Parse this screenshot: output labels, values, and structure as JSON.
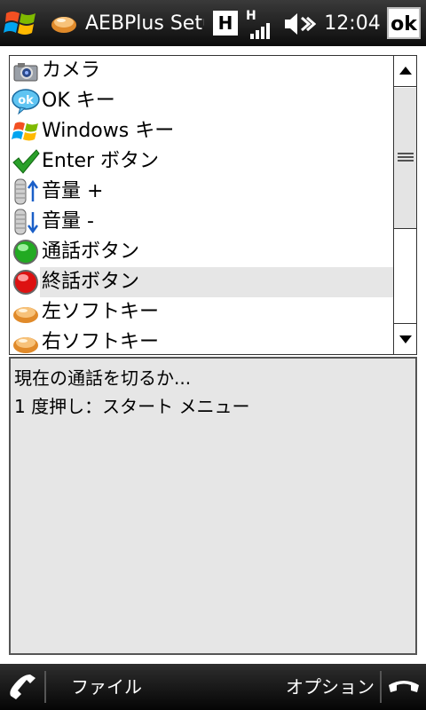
{
  "titlebar": {
    "app_title": "AEBPlus Setu",
    "network_type": "H",
    "signal_type": "H",
    "time": "12:04",
    "ok_label": "ok",
    "icons": [
      "windows-start-icon",
      "app-icon",
      "signal-strength-icon",
      "speaker-muted-icon"
    ]
  },
  "list": {
    "items": [
      {
        "label": "カメラ",
        "icon": "camera-icon"
      },
      {
        "label": "OK キー",
        "icon": "ok-key-icon"
      },
      {
        "label": "Windows キー",
        "icon": "windows-key-icon"
      },
      {
        "label": "Enter ボタン",
        "icon": "checkmark-icon"
      },
      {
        "label": "音量 +",
        "icon": "volume-up-icon"
      },
      {
        "label": "音量 -",
        "icon": "volume-down-icon"
      },
      {
        "label": "通話ボタン",
        "icon": "green-call-icon"
      },
      {
        "label": "終話ボタン",
        "icon": "red-end-call-icon"
      },
      {
        "label": "左ソフトキー",
        "icon": "left-softkey-icon"
      },
      {
        "label": "右ソフトキー",
        "icon": "right-softkey-icon"
      }
    ],
    "selected_index": 7
  },
  "description": {
    "line1": "現在の通話を切るか...",
    "line2": "1 度押し：スタート メニュー"
  },
  "bottombar": {
    "left_softkey": "ファイル",
    "right_softkey": "オプション"
  },
  "colors": {
    "titlebar_bg": "#1a1a1a",
    "selected_bg": "#e6e6e6",
    "description_bg": "#e6e6e6",
    "check_green": "#2aa02a",
    "call_green": "#22aa22",
    "end_red": "#dd1111"
  }
}
